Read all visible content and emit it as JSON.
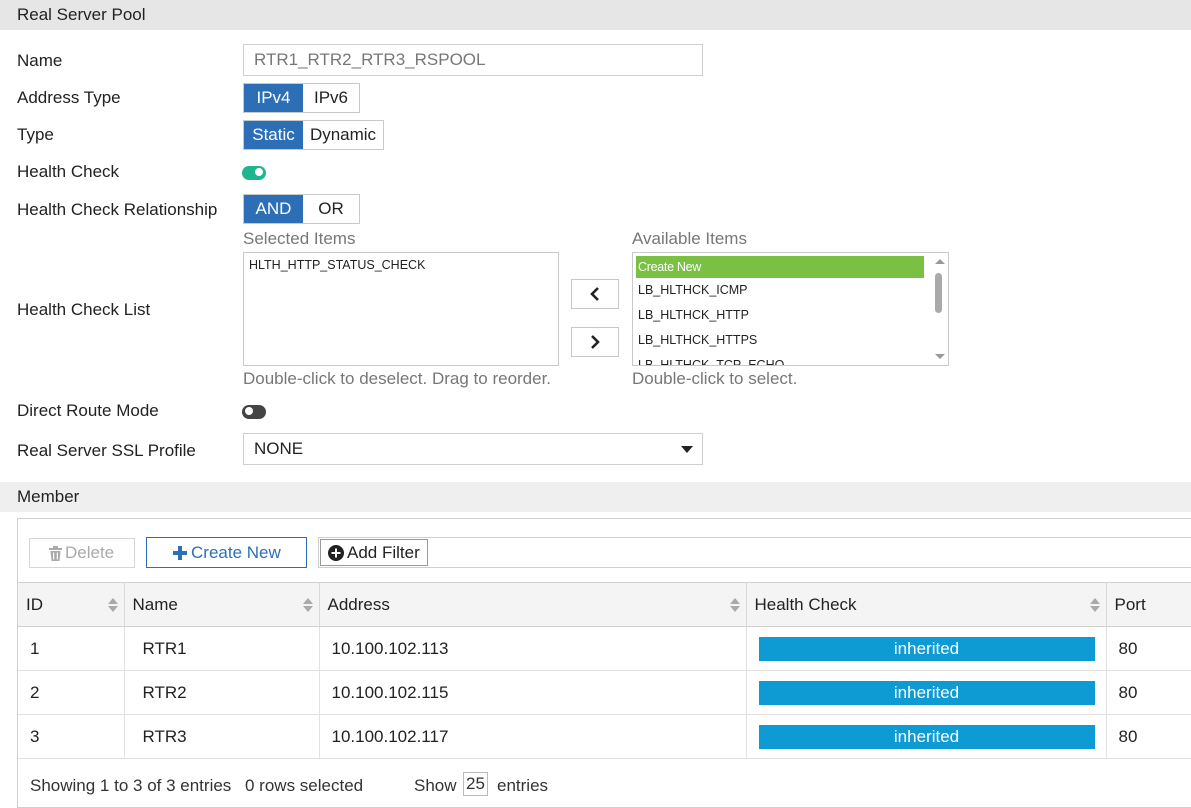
{
  "section_title": "Real Server Pool",
  "name_label": "Name",
  "name_value": "RTR1_RTR2_RTR3_RSPOOL",
  "address_type": {
    "label": "Address Type",
    "options": [
      "IPv4",
      "IPv6"
    ],
    "selected": "IPv4"
  },
  "type": {
    "label": "Type",
    "options": [
      "Static",
      "Dynamic"
    ],
    "selected": "Static"
  },
  "health_check": {
    "label": "Health Check",
    "enabled": true
  },
  "health_check_relationship": {
    "label": "Health Check Relationship",
    "options": [
      "AND",
      "OR"
    ],
    "selected": "AND"
  },
  "health_check_list": {
    "label": "Health Check List",
    "selected_title": "Selected Items",
    "selected_items": [
      "HLTH_HTTP_STATUS_CHECK"
    ],
    "selected_hint": "Double-click to deselect. Drag to reorder.",
    "available_title": "Available Items",
    "available_items": [
      "Create New",
      "LB_HLTHCK_ICMP",
      "LB_HLTHCK_HTTP",
      "LB_HLTHCK_HTTPS",
      "LB_HLTHCK_TCP_ECHO"
    ],
    "available_hint": "Double-click to select."
  },
  "direct_route_mode": {
    "label": "Direct Route Mode",
    "enabled": false
  },
  "ssl_profile": {
    "label": "Real Server SSL Profile",
    "value": "NONE"
  },
  "member": {
    "title": "Member",
    "toolbar": {
      "delete": "Delete",
      "create_new": "Create New",
      "add_filter": "Add Filter"
    },
    "columns": [
      "ID",
      "Name",
      "Address",
      "Health Check",
      "Port"
    ],
    "rows": [
      {
        "id": "1",
        "name": "RTR1",
        "address": "10.100.102.113",
        "health_check": "inherited",
        "port": "80"
      },
      {
        "id": "2",
        "name": "RTR2",
        "address": "10.100.102.115",
        "health_check": "inherited",
        "port": "80"
      },
      {
        "id": "3",
        "name": "RTR3",
        "address": "10.100.102.117",
        "health_check": "inherited",
        "port": "80"
      }
    ],
    "footer": {
      "showing": "Showing 1 to 3 of 3 entries",
      "selected": "0 rows selected",
      "show": "Show",
      "page_size": "25",
      "entries": "entries"
    }
  },
  "colors": {
    "primary": "#2c6fb7",
    "toggle_on": "#1fb58f",
    "create_new_highlight": "#7ac143",
    "badge": "#0e9ad3"
  }
}
